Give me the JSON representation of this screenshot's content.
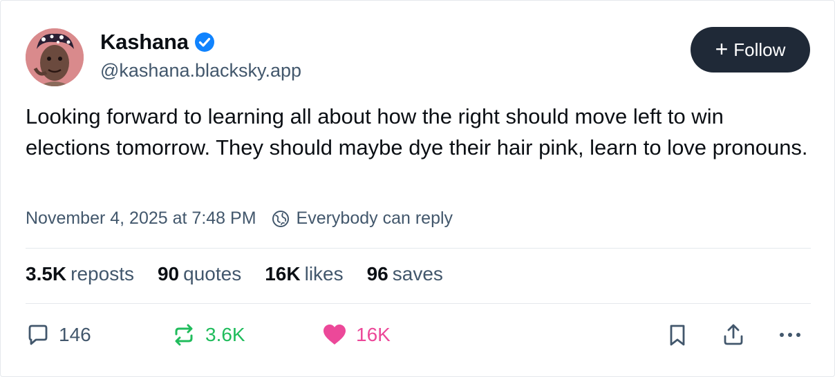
{
  "author": {
    "display_name": "Kashana",
    "handle": "@kashana.blacksky.app",
    "verified": true,
    "verified_color": "#1083fe"
  },
  "follow_button": {
    "label": "Follow"
  },
  "post": {
    "text": "Looking forward to learning all about how the right should move left to win elections tomorrow. They should maybe dye their hair pink, learn to love pronouns.",
    "timestamp": "November 4, 2025 at 7:48 PM",
    "reply_setting": "Everybody can reply"
  },
  "stats": [
    {
      "count": "3.5K",
      "label": "reposts"
    },
    {
      "count": "90",
      "label": "quotes"
    },
    {
      "count": "16K",
      "label": "likes"
    },
    {
      "count": "96",
      "label": "saves"
    }
  ],
  "actions": {
    "reply_count": "146",
    "repost_count": "3.6K",
    "like_count": "16K",
    "repost_color": "#20bc5c",
    "like_color": "#ec4899"
  },
  "icons": [
    "verified-icon",
    "plus-icon",
    "globe-icon",
    "reply-icon",
    "repost-icon",
    "like-icon",
    "bookmark-icon",
    "share-icon",
    "more-icon"
  ]
}
